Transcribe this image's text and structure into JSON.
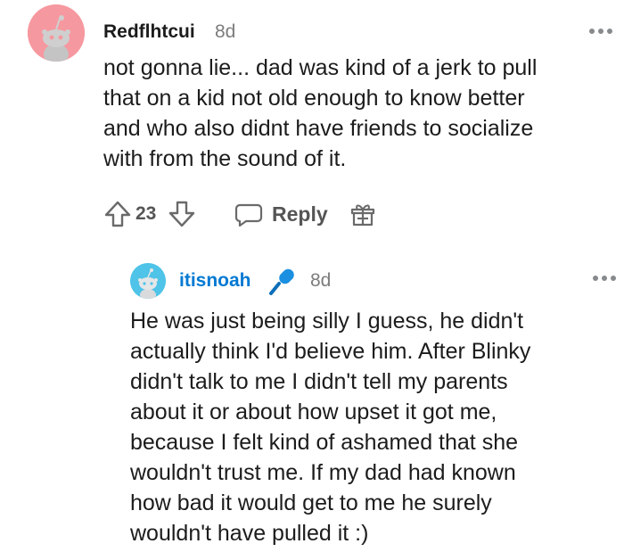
{
  "comments": [
    {
      "username": "Redflhtcui",
      "time": "8d",
      "body": "not gonna lie... dad was kind of a jerk to pull\nthat on a kid not old enough to know better\nand who also didnt have friends to socialize\nwith from the sound of it.",
      "score": "23",
      "reply_label": "Reply",
      "avatar_color": "#f6989f",
      "icons": [
        "upvote-icon",
        "downvote-icon",
        "reply-icon",
        "award-icon",
        "more-options-icon"
      ]
    },
    {
      "username": "itisnoah",
      "time": "8d",
      "body": "He was just being silly I guess, he didn't\nactually think I'd believe him. After Blinky\ndidn't talk to me I didn't tell my parents\nabout it or about how upset it got me,\nbecause I felt kind of ashamed that she\nwouldn't trust me. If my dad had known\nhow bad it would get to me he surely\nwouldn't have pulled it :)",
      "avatar_color": "#4fc3e8",
      "username_color": "#0079d3",
      "badge_icon": "microphone-icon"
    }
  ]
}
